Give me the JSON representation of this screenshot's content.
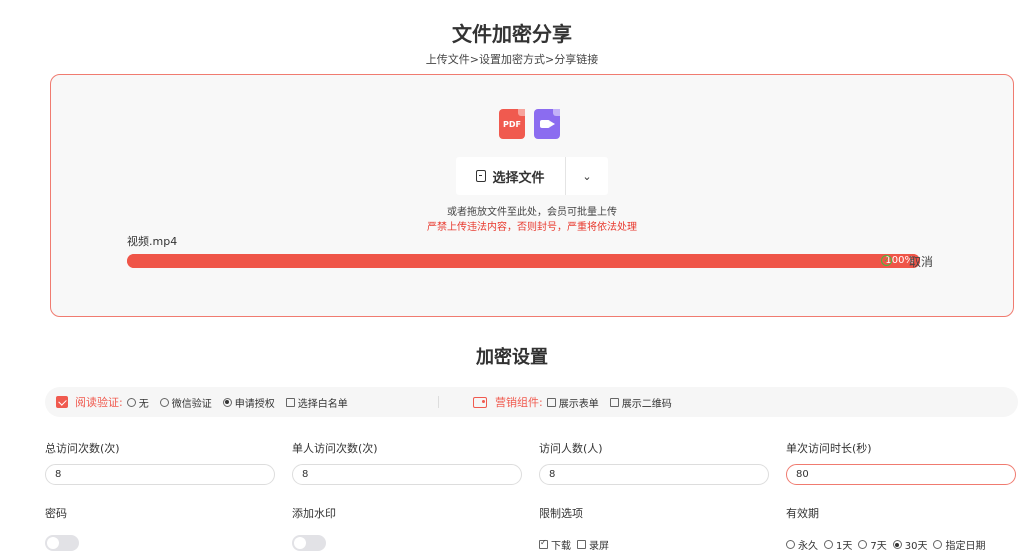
{
  "header": {
    "title": "文件加密分享",
    "steps": "上传文件>设置加密方式>分享链接"
  },
  "upload": {
    "pdf_icon_label": "PDF",
    "select_label": "选择文件",
    "dropdown_glyph": "⌄",
    "hint": "或者拖放文件至此处，会员可批量上传",
    "warning": "严禁上传违法内容，否则封号，严重将依法处理",
    "file_name": "视频.mp4",
    "progress_percent": 100,
    "progress_text": "100%",
    "cancel_label": "取消"
  },
  "settings": {
    "title": "加密设置",
    "reading_verification": {
      "label": "阅读验证:",
      "options": [
        "无",
        "微信验证",
        "申请授权",
        "选择白名单"
      ],
      "selected_index": 2
    },
    "marketing": {
      "label": "营销组件:",
      "options": [
        "展示表单",
        "展示二维码"
      ]
    },
    "fields": {
      "total_visits": {
        "label": "总访问次数(次)",
        "value": "8"
      },
      "single_visits": {
        "label": "单人访问次数(次)",
        "value": "8"
      },
      "visitors": {
        "label": "访问人数(人)",
        "value": "8"
      },
      "duration": {
        "label": "单次访问时长(秒)",
        "value": "80"
      }
    },
    "password": {
      "label": "密码"
    },
    "watermark": {
      "label": "添加水印"
    },
    "restrictions": {
      "label": "限制选项",
      "options": [
        {
          "label": "下载",
          "checked": true
        },
        {
          "label": "录屏",
          "checked": false
        }
      ]
    },
    "validity": {
      "label": "有效期",
      "options": [
        "永久",
        "1天",
        "7天",
        "30天",
        "指定日期"
      ],
      "selected_index": 3
    }
  }
}
